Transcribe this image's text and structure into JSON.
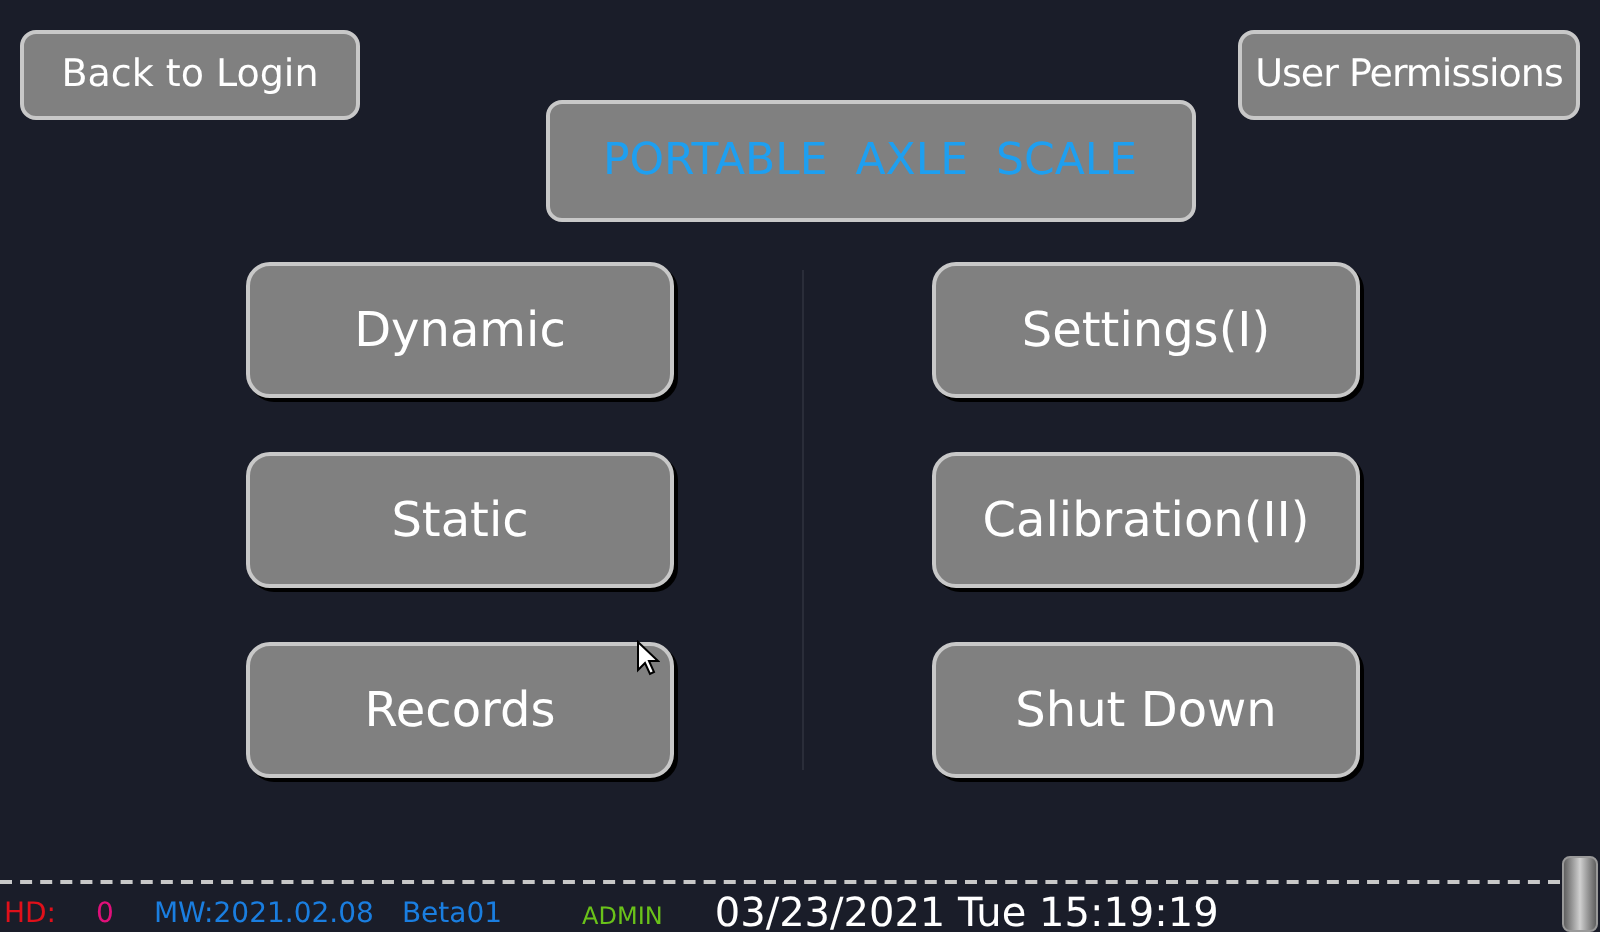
{
  "top_buttons": [
    {
      "label": "Back to Login"
    },
    {
      "label": "User Permissions"
    }
  ],
  "title": "PORTABLE  AXLE  SCALE",
  "left_buttons": [
    {
      "label": "Dynamic"
    },
    {
      "label": "Static"
    },
    {
      "label": "Records"
    }
  ],
  "right_buttons": [
    {
      "label": "Settings(I)"
    },
    {
      "label": "Calibration(II)"
    },
    {
      "label": "Shut Down"
    }
  ],
  "status_bar": {
    "items": [
      {
        "text": "HD:",
        "color": "#e0101a"
      },
      {
        "text": "0",
        "color": "#e0107a"
      },
      {
        "text": "MW:2021.02.08",
        "color": "#1a7ee0"
      },
      {
        "text": "Beta01",
        "color": "#1a7ee0"
      },
      {
        "text": "ADMIN",
        "color": "#6ac21a"
      }
    ],
    "datetime": "03/23/2021 Tue 15:19:19"
  }
}
